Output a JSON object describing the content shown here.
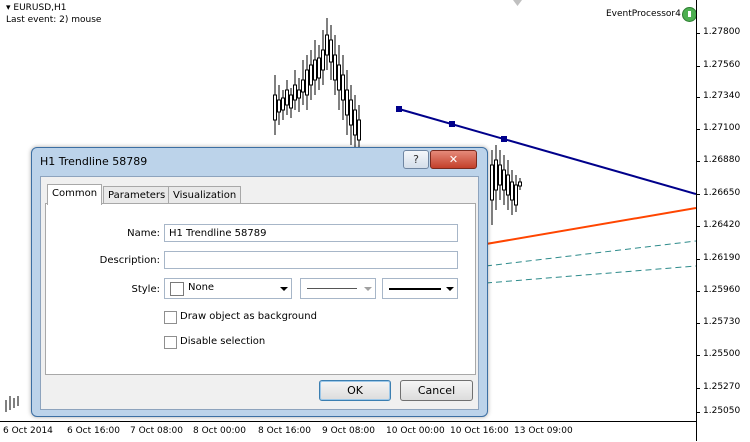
{
  "chart": {
    "symbol": "EURUSD,H1",
    "last_event": "Last event: 2) mouse",
    "indicator_name": "EventProcessor4",
    "price_labels": [
      "1.27800",
      "1.27560",
      "1.27340",
      "1.27100",
      "1.26880",
      "1.26650",
      "1.26420",
      "1.26190",
      "1.25960",
      "1.25730",
      "1.25500",
      "1.25270",
      "1.25050"
    ],
    "time_labels": [
      "6 Oct 2014",
      "6 Oct 16:00",
      "7 Oct 08:00",
      "8 Oct 00:00",
      "8 Oct 16:00",
      "9 Oct 08:00",
      "10 Oct 00:00",
      "10 Oct 16:00",
      "13 Oct 09:00"
    ],
    "colors": {
      "trendline_selected": "#00008b",
      "trendline_orange": "#ff4500",
      "trendline_teal": "#2e8b8b",
      "candles": "#000000"
    }
  },
  "dialog": {
    "title": "H1 Trendline 58789",
    "help_label": "?",
    "close_label": "✕",
    "tabs": [
      "Common",
      "Parameters",
      "Visualization"
    ],
    "active_tab": "Common",
    "name_label": "Name:",
    "name_value": "H1 Trendline 58789",
    "description_label": "Description:",
    "description_value": "",
    "style_label": "Style:",
    "color_value": "None",
    "draw_background_label": "Draw object as background",
    "disable_selection_label": "Disable selection",
    "draw_background_checked": false,
    "disable_selection_checked": false,
    "ok_label": "OK",
    "cancel_label": "Cancel"
  }
}
